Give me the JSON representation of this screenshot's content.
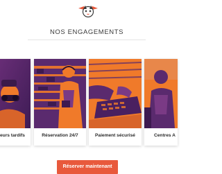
{
  "header": {
    "logo_icon": "fox-mascot-logo",
    "title": "NOS ENGAGEMENTS"
  },
  "cards": [
    {
      "label": "eurs tardifs",
      "image": "person-with-binoculars-photo"
    },
    {
      "label": "Réservation 24/7",
      "image": "customer-support-agent-headset-photo"
    },
    {
      "label": "Paiement sécurisé",
      "image": "hands-on-laptop-photo"
    },
    {
      "label": "Centres A",
      "image": "person-in-office-photo"
    }
  ],
  "cta": {
    "label": "Réserver maintenant"
  },
  "colors": {
    "accent": "#e8593c",
    "overlay_purple": "#5a2a6e",
    "overlay_orange": "#f07a2a"
  }
}
